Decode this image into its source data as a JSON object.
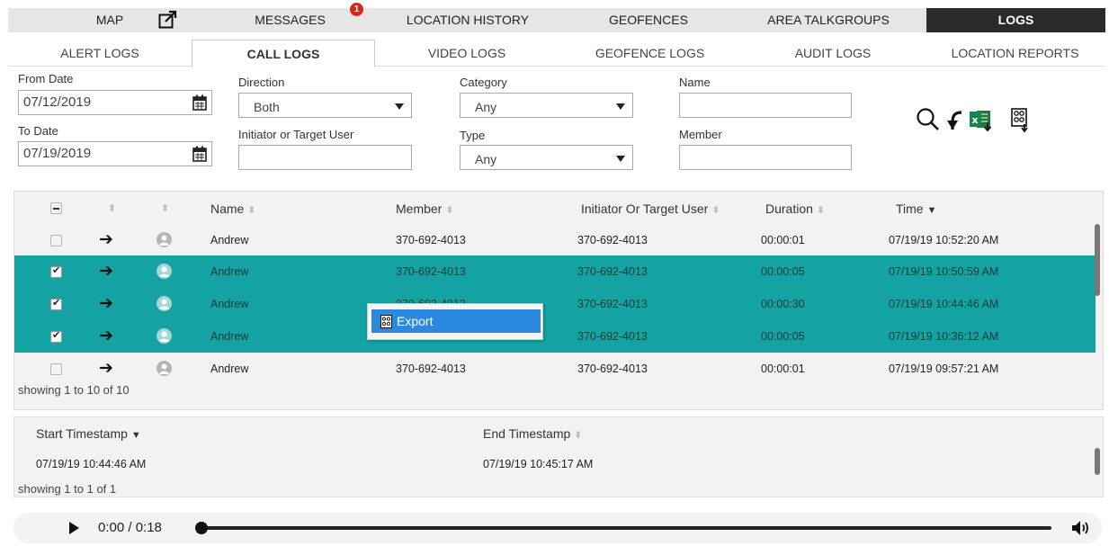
{
  "topnav": {
    "items": [
      {
        "label": "MAP"
      },
      {
        "label": "MESSAGES",
        "badge": "1"
      },
      {
        "label": "LOCATION HISTORY"
      },
      {
        "label": "GEOFENCES"
      },
      {
        "label": "AREA TALKGROUPS"
      },
      {
        "label": "LOGS",
        "active": true
      }
    ],
    "popout_icon": "popout-icon"
  },
  "subtabs": [
    {
      "label": "ALERT LOGS"
    },
    {
      "label": "CALL LOGS",
      "active": true
    },
    {
      "label": "VIDEO LOGS"
    },
    {
      "label": "GEOFENCE LOGS"
    },
    {
      "label": "AUDIT LOGS"
    },
    {
      "label": "LOCATION REPORTS"
    }
  ],
  "filters": {
    "from_date_label": "From Date",
    "from_date": "07/12/2019",
    "to_date_label": "To Date",
    "to_date": "07/19/2019",
    "direction_label": "Direction",
    "direction": "Both",
    "initiator_label": "Initiator or Target User",
    "initiator": "",
    "category_label": "Category",
    "category": "Any",
    "type_label": "Type",
    "type": "Any",
    "name_label": "Name",
    "name": "",
    "member_label": "Member",
    "member": ""
  },
  "tools": [
    "search-icon",
    "reset-icon",
    "excel-export-icon",
    "export-icon"
  ],
  "calls_table": {
    "headers": {
      "name": "Name",
      "member": "Member",
      "initiator": "Initiator Or Target User",
      "duration": "Duration",
      "time": "Time"
    },
    "rows": [
      {
        "checked": false,
        "name": "Andrew",
        "member": "370-692-4013",
        "initiator": "370-692-4013",
        "duration": "00:00:01",
        "time": "07/19/19 10:52:20 AM"
      },
      {
        "checked": true,
        "name": "Andrew",
        "member": "370-692-4013",
        "initiator": "370-692-4013",
        "duration": "00:00:05",
        "time": "07/19/19 10:50:59 AM"
      },
      {
        "checked": true,
        "name": "Andrew",
        "member": "370-692-4013",
        "initiator": "370-692-4013",
        "duration": "00:00:30",
        "time": "07/19/19 10:44:46 AM"
      },
      {
        "checked": true,
        "name": "Andrew",
        "member": "",
        "initiator": "370-692-4013",
        "duration": "00:00:05",
        "time": "07/19/19 10:36:12 AM"
      },
      {
        "checked": false,
        "name": "Andrew",
        "member": "370-692-4013",
        "initiator": "370-692-4013",
        "duration": "00:00:01",
        "time": "07/19/19 09:57:21 AM"
      }
    ],
    "showing": "showing 1 to 10 of 10"
  },
  "context_menu": {
    "item": "Export"
  },
  "segments_table": {
    "headers": {
      "start": "Start Timestamp",
      "end": "End Timestamp"
    },
    "rows": [
      {
        "start": "07/19/19 10:44:46 AM",
        "end": "07/19/19 10:45:17 AM"
      }
    ],
    "showing": "showing 1 to 1 of 1"
  },
  "audio": {
    "time": "0:00 / 0:18",
    "progress": 0
  },
  "colors": {
    "selected_row": "#14a2a2",
    "active_tab": "#2b2b2b",
    "menu_highlight": "#2b8ae0",
    "badge": "#d9261c"
  }
}
